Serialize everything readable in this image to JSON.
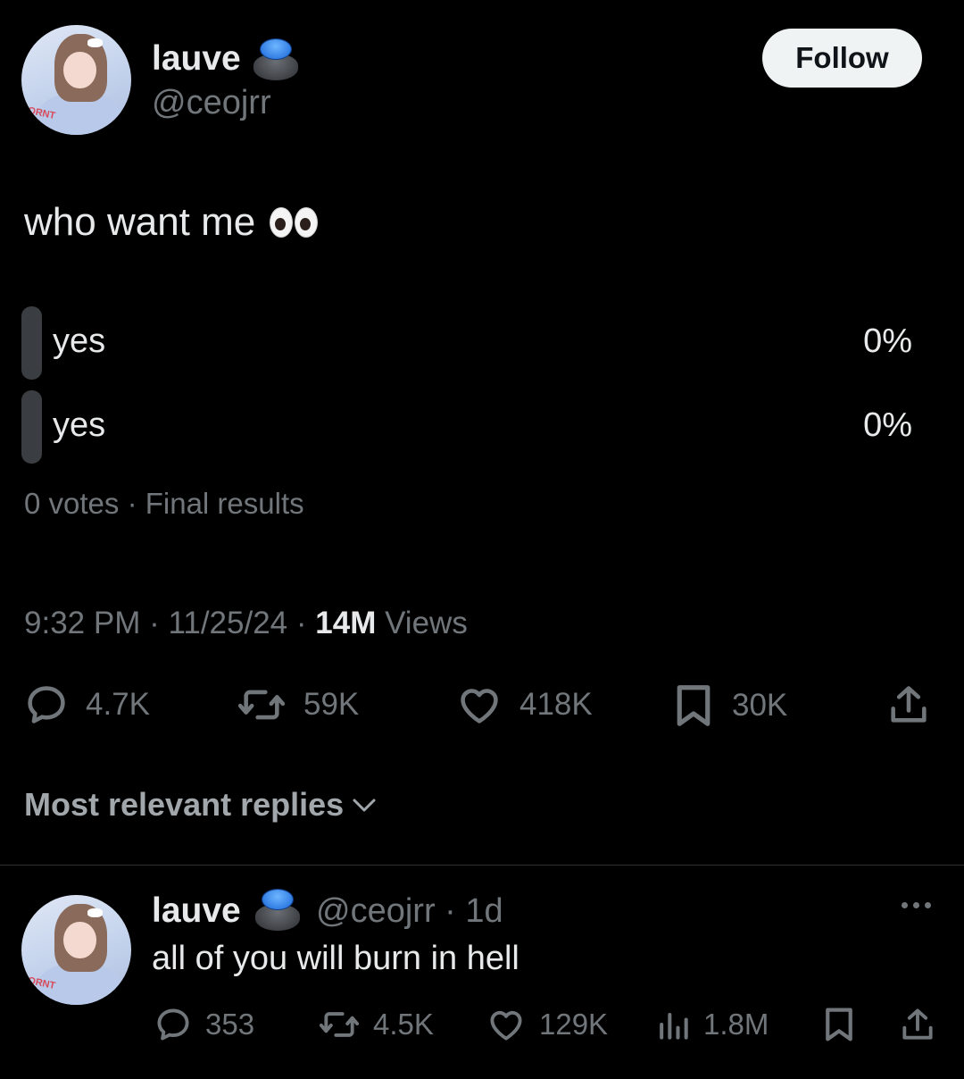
{
  "post": {
    "author_name": "lauve",
    "author_handle": "@ceojrr",
    "follow_label": "Follow",
    "text": "who want me",
    "poll": {
      "options": [
        {
          "label": "yes",
          "percent": "0%"
        },
        {
          "label": "yes",
          "percent": "0%"
        }
      ],
      "summary": "0 votes · Final results"
    },
    "time": "9:32 PM",
    "date": "11/25/24",
    "sep": "·",
    "views_count": "14M",
    "views_label": "Views",
    "stats": {
      "replies": "4.7K",
      "reposts": "59K",
      "likes": "418K",
      "bookmarks": "30K"
    }
  },
  "replies_sort": {
    "label": "Most relevant replies"
  },
  "reply": {
    "author_name": "lauve",
    "author_handle": "@ceojrr",
    "age": "· 1d",
    "text": "all of you will burn in hell",
    "stats": {
      "replies": "353",
      "reposts": "4.5K",
      "likes": "129K",
      "views": "1.8M"
    }
  },
  "colors": {
    "background": "#000000",
    "text_primary": "#e7e9ea",
    "text_secondary": "#71767b",
    "poll_bar": "#3a3d41",
    "follow_bg": "#eff3f4",
    "badge_blue": "#1d73e8"
  },
  "icons": [
    "eyes-emoji",
    "verified-badge-button",
    "reply-icon",
    "repost-icon",
    "like-icon",
    "bookmark-icon",
    "share-icon",
    "views-icon",
    "chevron-down-icon",
    "more-icon"
  ]
}
